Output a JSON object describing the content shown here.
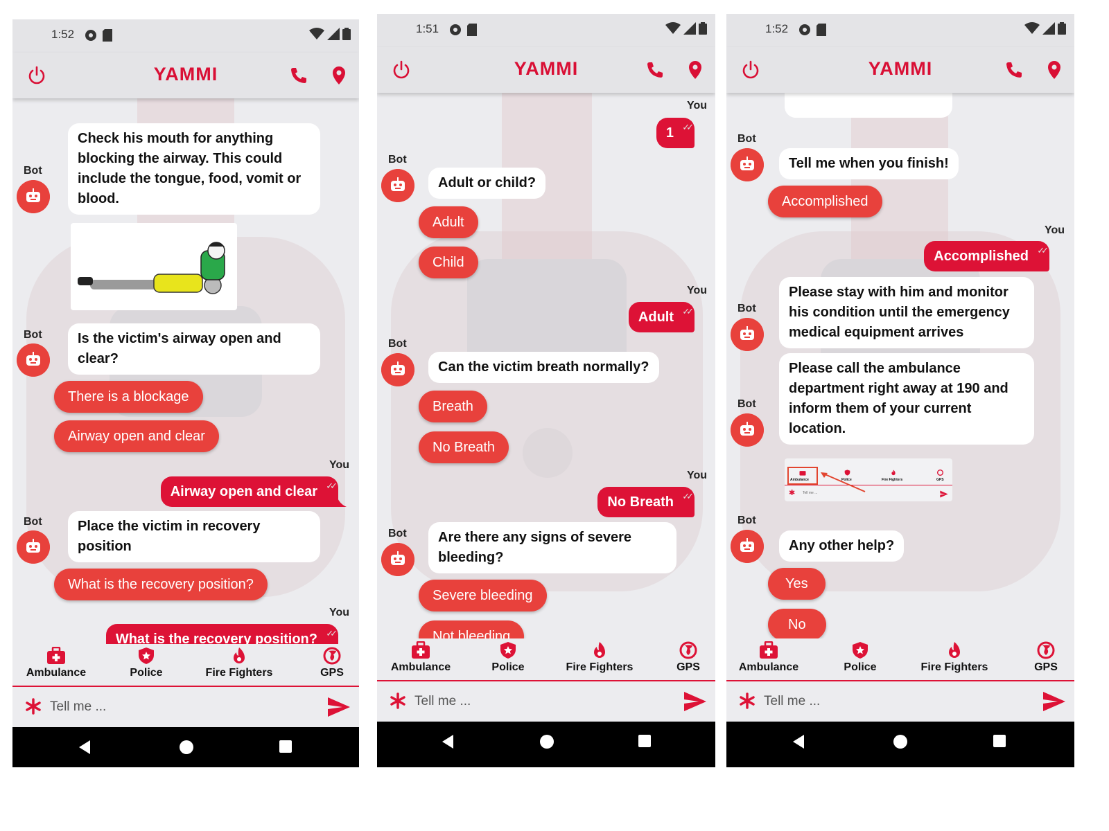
{
  "app": {
    "title": "YAMMI"
  },
  "status_times": [
    "1:52",
    "1:51",
    "1:52"
  ],
  "labels": {
    "bot": "Bot",
    "you": "You"
  },
  "nav": {
    "ambulance": "Ambulance",
    "police": "Police",
    "fire": "Fire Fighters",
    "gps": "GPS"
  },
  "composer": {
    "placeholder": "Tell me ..."
  },
  "colors": {
    "brand_red": "#dd1236",
    "chip_red": "#e8413c",
    "background": "#ececef"
  },
  "screen1": {
    "bot_mouth": "Check his mouth for anything blocking the airway. This could include the tongue, food, vomit or blood.",
    "bot_airway": "Is the victim's airway open and clear?",
    "opt_blockage": "There is a blockage",
    "opt_airway_open": "Airway open and clear",
    "user_airway_open": "Airway open and clear",
    "bot_recovery": "Place the victim in recovery position",
    "opt_recovery": "What is the recovery position?",
    "user_recovery": "What is the recovery position?"
  },
  "screen2": {
    "user_one": "1",
    "bot_adult_child": "Adult or child?",
    "opt_adult": "Adult",
    "opt_child": "Child",
    "user_adult": "Adult",
    "bot_breath": "Can the victim breath normally?",
    "opt_breath": "Breath",
    "opt_no_breath": "No Breath",
    "user_no_breath": "No Breath",
    "bot_bleeding": "Are there any signs of severe bleeding?",
    "opt_severe": "Severe bleeding",
    "opt_not_bleeding": "Not bleeding"
  },
  "screen3": {
    "bot_finish": "Tell me when you finish!",
    "opt_accomplished": "Accomplished",
    "user_accomplished": "Accomplished",
    "bot_stay": "Please stay with him and monitor his condition until the emergency medical equipment arrives",
    "bot_call": "Please call the ambulance department right away at 190 and inform them of your current location.",
    "thumb_ambulance": "Ambulance",
    "thumb_police": "Police",
    "thumb_fire": "Fire Fighters",
    "thumb_gps": "GPS",
    "thumb_tell": "Tell me ...",
    "bot_other": "Any other help?",
    "opt_yes": "Yes",
    "opt_no": "No"
  }
}
